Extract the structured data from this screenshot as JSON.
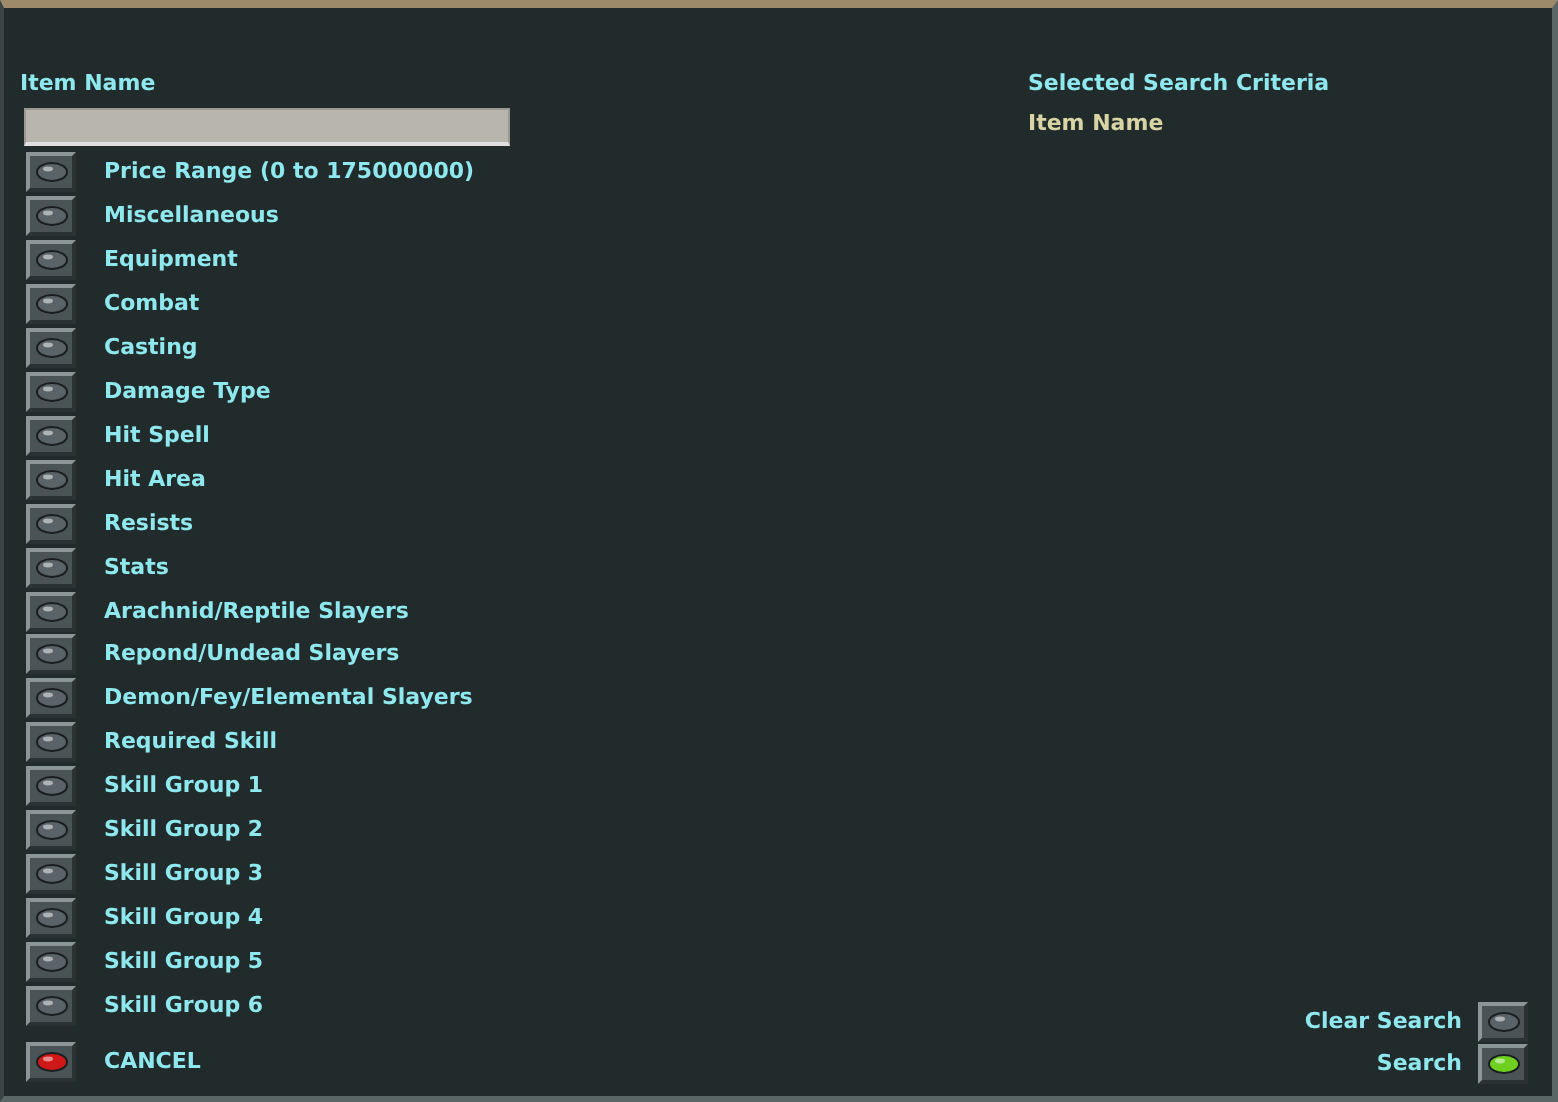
{
  "item_name": {
    "label": "Item Name"
  },
  "categories": [
    {
      "label": "Price Range (0 to 175000000)",
      "color": "#5a6468"
    },
    {
      "label": "Miscellaneous",
      "color": "#5a6468"
    },
    {
      "label": "Equipment",
      "color": "#5a6468"
    },
    {
      "label": "Combat",
      "color": "#5a6468"
    },
    {
      "label": "Casting",
      "color": "#5a6468"
    },
    {
      "label": "Damage Type",
      "color": "#5a6468"
    },
    {
      "label": "Hit Spell",
      "color": "#5a6468"
    },
    {
      "label": "Hit Area",
      "color": "#5a6468"
    },
    {
      "label": "Resists",
      "color": "#5a6468"
    },
    {
      "label": "Stats",
      "color": "#5a6468"
    },
    {
      "label": "Arachnid/Reptile Slayers",
      "color": "#5a6468"
    },
    {
      "label": "Repond/Undead Slayers",
      "color": "#5a6468"
    },
    {
      "label": "Demon/Fey/Elemental Slayers",
      "color": "#5a6468"
    },
    {
      "label": "Required Skill",
      "color": "#5a6468"
    },
    {
      "label": "Skill Group 1",
      "color": "#5a6468"
    },
    {
      "label": "Skill Group 2",
      "color": "#5a6468"
    },
    {
      "label": "Skill Group 3",
      "color": "#5a6468"
    },
    {
      "label": "Skill Group 4",
      "color": "#5a6468"
    },
    {
      "label": "Skill Group 5",
      "color": "#5a6468"
    },
    {
      "label": "Skill Group 6",
      "color": "#5a6468"
    }
  ],
  "cancel": {
    "label": "CANCEL",
    "color": "#d01818"
  },
  "criteria": {
    "title": "Selected Search Criteria",
    "items": [
      "Item Name"
    ]
  },
  "actions": [
    {
      "label": "Clear Search",
      "color": "#5a6468"
    },
    {
      "label": "Search",
      "color": "#6fd020"
    }
  ]
}
